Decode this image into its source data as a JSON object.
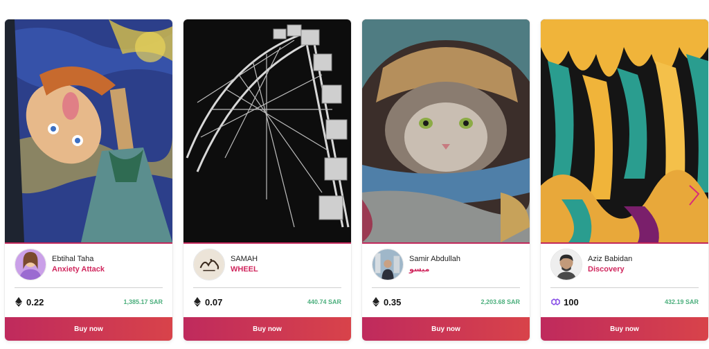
{
  "cards": [
    {
      "creator": "Ebtihal Taha",
      "title": "Anxiety Attack",
      "currency_icon": "ethereum-icon",
      "crypto_price": "0.22",
      "fiat_price": "1,385.17 SAR",
      "buy_label": "Buy now"
    },
    {
      "creator": "SAMAH",
      "title": "WHEEL",
      "currency_icon": "ethereum-icon",
      "crypto_price": "0.07",
      "fiat_price": "440.74 SAR",
      "buy_label": "Buy now"
    },
    {
      "creator": "Samir Abdullah",
      "title": "ميسو",
      "currency_icon": "ethereum-icon",
      "crypto_price": "0.35",
      "fiat_price": "2,203.68 SAR",
      "buy_label": "Buy now"
    },
    {
      "creator": "Aziz Babidan",
      "title": "Discovery",
      "currency_icon": "polygon-icon",
      "crypto_price": "100",
      "fiat_price": "432.19 SAR",
      "buy_label": "Buy now"
    }
  ],
  "colors": {
    "accent": "#d0265d",
    "fiat_price": "#4caf7d",
    "button_gradient_start": "#bf2a5d",
    "button_gradient_end": "#d8434a",
    "polygon": "#8247e5"
  }
}
